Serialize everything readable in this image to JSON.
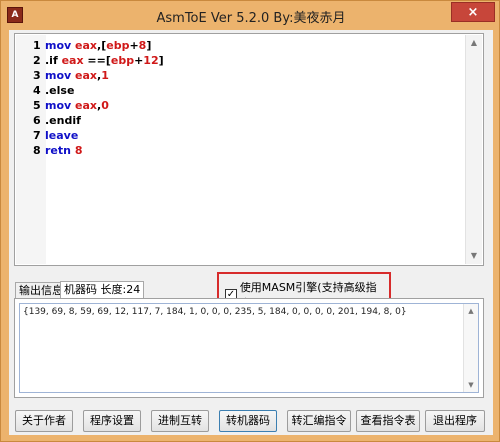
{
  "window": {
    "title": "AsmToE Ver 5.2.0  By:美夜赤月",
    "close_glyph": "×",
    "app_icon_glyph": "A"
  },
  "editor": {
    "lines": [
      {
        "num": "1",
        "tokens": [
          {
            "t": "mov ",
            "c": "kw"
          },
          {
            "t": "eax",
            "c": "rg"
          },
          {
            "t": ",[",
            "c": "op"
          },
          {
            "t": "ebp",
            "c": "rg"
          },
          {
            "t": "+",
            "c": "op"
          },
          {
            "t": "8",
            "c": "nm"
          },
          {
            "t": "]",
            "c": "op"
          }
        ]
      },
      {
        "num": "2",
        "tokens": [
          {
            "t": ".if ",
            "c": "dr"
          },
          {
            "t": "eax ",
            "c": "rg"
          },
          {
            "t": "==[",
            "c": "op"
          },
          {
            "t": "ebp",
            "c": "rg"
          },
          {
            "t": "+",
            "c": "op"
          },
          {
            "t": "12",
            "c": "nm"
          },
          {
            "t": "]",
            "c": "op"
          }
        ]
      },
      {
        "num": "3",
        "tokens": [
          {
            "t": "mov ",
            "c": "kw"
          },
          {
            "t": "eax",
            "c": "rg"
          },
          {
            "t": ",",
            "c": "op"
          },
          {
            "t": "1",
            "c": "nm"
          }
        ]
      },
      {
        "num": "4",
        "tokens": [
          {
            "t": ".else",
            "c": "dr"
          }
        ]
      },
      {
        "num": "5",
        "tokens": [
          {
            "t": "mov ",
            "c": "kw"
          },
          {
            "t": "eax",
            "c": "rg"
          },
          {
            "t": ",",
            "c": "op"
          },
          {
            "t": "0",
            "c": "nm"
          }
        ]
      },
      {
        "num": "6",
        "tokens": [
          {
            "t": ".endif",
            "c": "dr"
          }
        ]
      },
      {
        "num": "7",
        "tokens": [
          {
            "t": "leave",
            "c": "kw"
          }
        ]
      },
      {
        "num": "8",
        "tokens": [
          {
            "t": "retn ",
            "c": "kw"
          },
          {
            "t": "8",
            "c": "nm"
          }
        ]
      }
    ]
  },
  "tabs": [
    {
      "label": "输出信息",
      "active": false
    },
    {
      "label": "机器码 长度:24",
      "active": true
    }
  ],
  "masm": {
    "checked": true,
    "check_glyph": "✓",
    "label": "使用MASM引擎(支持高级指令)"
  },
  "output": {
    "text": "{139, 69, 8, 59, 69, 12, 117, 7, 184, 1, 0, 0, 0, 235, 5, 184, 0, 0, 0, 0, 201, 194, 8, 0}"
  },
  "scroll_glyphs": {
    "up": "▲",
    "down": "▼"
  },
  "buttons": [
    {
      "label": "关于作者"
    },
    {
      "label": "程序设置"
    },
    {
      "label": "进制互转"
    },
    {
      "label": "转机器码"
    },
    {
      "label": "转汇编指令"
    },
    {
      "label": "查看指令表"
    },
    {
      "label": "退出程序"
    }
  ],
  "colors": {
    "keyword": "#1010c8",
    "register": "#d01818",
    "highlight_border": "#d72b2b",
    "frame": "#ecb36d"
  }
}
